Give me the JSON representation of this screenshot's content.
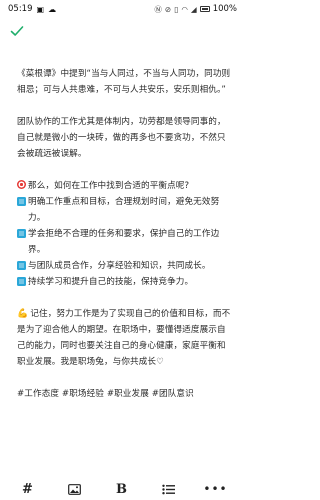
{
  "status_bar": {
    "time": "05:19",
    "battery": "100%"
  },
  "post": {
    "paragraphs": [
      "《菜根谭》中提到“当与人同过，不当与人同功，同功则相忌；可与人共患难，不可与人共安乐，安乐则相仇。”",
      "团队协作的工作尤其是体制内，功劳都是领导同事的，自己就是微小的一块砖，做的再多也不要贪功，不然只会被疏远被误解。"
    ],
    "question": "那么，如何在工作中找到合适的平衡点呢?",
    "tips": [
      "明确工作重点和目标，合理规划时间，避免无效努力。",
      "学会拒绝不合理的任务和要求，保护自己的工作边界。",
      "与团队成员合作，分享经验和知识，共同成长。",
      "持续学习和提升自己的技能，保持竞争力。"
    ],
    "closing": "记住，努力工作是为了实现自己的价值和目标，而不是为了迎合他人的期望。在职场中，要懂得适度展示自己的能力，同时也要关注自己的身心健康，家庭平衡和职业发展。我是职场兔，与你共成长♡",
    "hashtags": "#工作态度 #职场经验 #职业发展 #团队意识"
  },
  "icons": {
    "confirm": "check-icon",
    "question_emoji": "target-icon",
    "tip_emoji": "blue-square-icon",
    "closing_emoji": "flexed-biceps-icon"
  },
  "colors": {
    "accent": "#1fae6b",
    "tip_square": "#2aa7d8",
    "target": "#e53935"
  }
}
